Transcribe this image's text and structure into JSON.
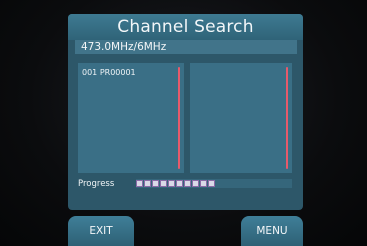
{
  "title": "Channel Search",
  "frequency": "473.0MHz/6MHz",
  "channels_found": [
    "001 PR00001"
  ],
  "progress": {
    "label": "Progress",
    "filled_segments": 10,
    "fraction": 0.45
  },
  "softkeys": {
    "exit": "EXIT",
    "menu": "MENU"
  },
  "colors": {
    "panel": "#2d5769",
    "title_bar": "#3e7a92",
    "list_bg": "#3a6f86",
    "scrollbar": "#e85a6b",
    "progress_segment": "#d9d9e8"
  }
}
